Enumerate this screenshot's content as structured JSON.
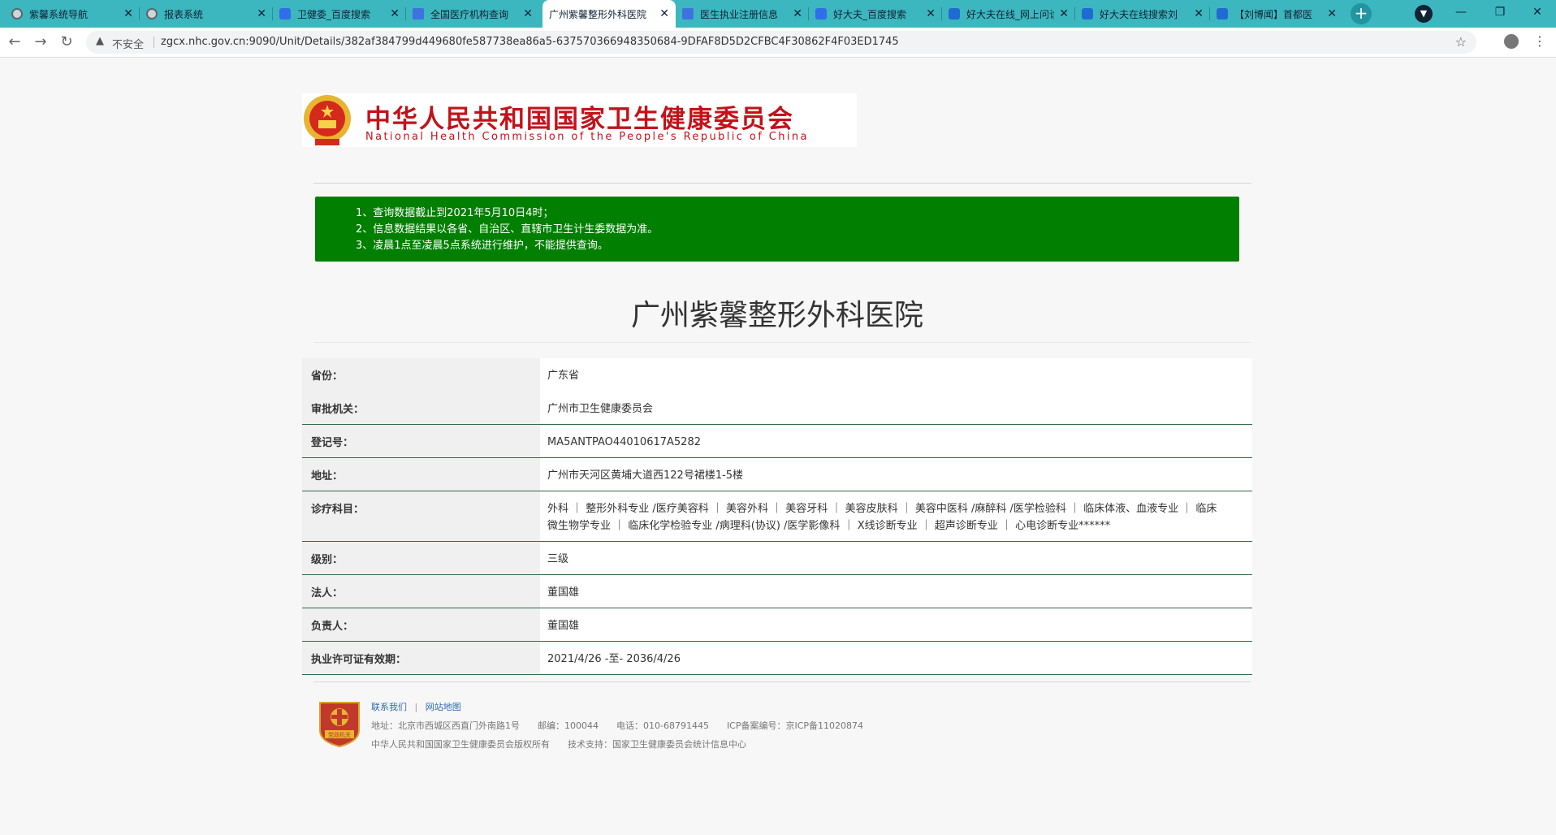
{
  "browser": {
    "tabs": [
      {
        "title": "紫馨系统导航",
        "icon": "globe-icon"
      },
      {
        "title": "报表系统",
        "icon": "globe-icon"
      },
      {
        "title": "卫健委_百度搜索",
        "icon": "baidu-icon"
      },
      {
        "title": "全国医疗机构查询",
        "icon": "doc-icon"
      },
      {
        "title": "广州紫馨整形外科医院",
        "icon": "page-icon"
      },
      {
        "title": "医生执业注册信息",
        "icon": "doc-icon"
      },
      {
        "title": "好大夫_百度搜索",
        "icon": "baidu-icon"
      },
      {
        "title": "好大夫在线_网上问诊",
        "icon": "haodf-icon"
      },
      {
        "title": "好大夫在线搜索刘",
        "icon": "haodf-icon"
      },
      {
        "title": "【刘博闻】首都医",
        "icon": "haodf-icon"
      }
    ],
    "active_tab": 4,
    "new_tab": "+",
    "security_label": "不安全",
    "url": "zgcx.nhc.gov.cn:9090/Unit/Details/382af384799d449680fe587738ea86a5-637570366948350684-9DFAF8D5D2CFBC4F30862F4F03ED1745"
  },
  "header": {
    "title_cn": "中华人民共和国国家卫生健康委员会",
    "title_en": "National Health Commission of the People's Republic of China"
  },
  "notice": {
    "lines": [
      "1、查询数据截止到2021年5月10日4时；",
      "2、信息数据结果以各省、自治区、直辖市卫生计生委数据为准。",
      "3、凌晨1点至凌晨5点系统进行维护，不能提供查询。"
    ]
  },
  "hospital": {
    "name": "广州紫馨整形外科医院",
    "fields": [
      {
        "label": "省份：",
        "value": "广东省"
      },
      {
        "label": "审批机关：",
        "value": "广州市卫生健康委员会"
      },
      {
        "label": "登记号：",
        "value": "MA5ANTPAO44010617A5282"
      },
      {
        "label": "地址：",
        "value": "广州市天河区黄埔大道西122号裙楼1-5楼"
      },
      {
        "label": "诊疗科目：",
        "value": "外科 ｜ 整形外科专业 /医疗美容科 ｜ 美容外科 ｜ 美容牙科 ｜ 美容皮肤科 ｜ 美容中医科 /麻醉科 /医学检验科 ｜ 临床体液、血液专业 ｜ 临床微生物学专业 ｜ 临床化学检验专业 /病理科(协议) /医学影像科 ｜ X线诊断专业 ｜ 超声诊断专业 ｜ 心电诊断专业******"
      },
      {
        "label": "级别：",
        "value": "三级"
      },
      {
        "label": "法人：",
        "value": "董国雄"
      },
      {
        "label": "负责人：",
        "value": "董国雄"
      },
      {
        "label": "执业许可证有效期：",
        "value": "2021/4/26 -至- 2036/4/26"
      }
    ]
  },
  "footer": {
    "contact": "联系我们",
    "link_sep": "|",
    "sitemap": "网站地图",
    "address_line": "地址：北京市西城区西直门外南路1号　　邮编：100044　　电话：010-68791445　　ICP备案编号：京ICP备11020874",
    "copyright_line": "中华人民共和国国家卫生健康委员会版权所有　　技术支持：国家卫生健康委员会统计信息中心",
    "badge_text": "党政机关"
  },
  "colors": {
    "tabstrip": "#3cb6bf",
    "notice_bg": "#007f00",
    "logo_red": "#c3121a",
    "row_border": "#2e6b42"
  }
}
